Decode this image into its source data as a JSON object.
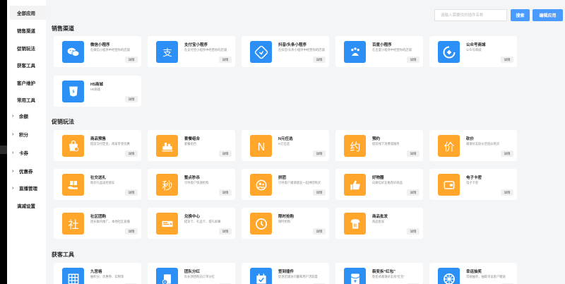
{
  "sidebar": {
    "items": [
      {
        "label": "全部应用",
        "has_arrow": false,
        "active": true
      },
      {
        "label": "销售渠道",
        "has_arrow": false
      },
      {
        "label": "促销玩法",
        "has_arrow": false
      },
      {
        "label": "获客工具",
        "has_arrow": false
      },
      {
        "label": "客户维护",
        "has_arrow": false
      },
      {
        "label": "常用工具",
        "has_arrow": false
      },
      {
        "label": "余额",
        "has_arrow": true
      },
      {
        "label": "积分",
        "has_arrow": true
      },
      {
        "label": "卡券",
        "has_arrow": true
      },
      {
        "label": "优惠券",
        "has_arrow": true
      },
      {
        "label": "直播管理",
        "has_arrow": true
      },
      {
        "label": "满减设置",
        "has_arrow": false
      }
    ]
  },
  "search": {
    "placeholder": "请输入需要找的插件名称",
    "search_label": "搜索",
    "edit_label": "编辑应用"
  },
  "detail_label": "详情",
  "sections": [
    {
      "title": "销售渠道",
      "cards": [
        {
          "name": "微信小程序",
          "desc": "在微信小程序中经营你的店铺",
          "icon": "wechat-icon",
          "color": "blue"
        },
        {
          "name": "支付宝小程序",
          "desc": "在支付宝小程序中经营你的店铺",
          "icon": "alipay-icon",
          "color": "blue"
        },
        {
          "name": "抖音/头条小程序",
          "desc": "在抖音/头条小程序中经营你的店铺",
          "icon": "douyin-icon",
          "color": "blue"
        },
        {
          "name": "百度小程序",
          "desc": "在百度小程序中经营你的店铺",
          "icon": "baidu-icon",
          "color": "blue"
        },
        {
          "name": "公众号商城",
          "desc": "公众号商城",
          "icon": "official-account-icon",
          "color": "blue"
        },
        {
          "name": "H5商城",
          "desc": "H5商城",
          "icon": "html5-icon",
          "color": "blue"
        }
      ]
    },
    {
      "title": "促销玩法",
      "cards": [
        {
          "name": "商品预售",
          "desc": "提前交付定金，商家享受优惠",
          "icon": "presale-bag-icon",
          "color": "orange"
        },
        {
          "name": "套餐组合",
          "desc": "套餐组合",
          "icon": "package-combo-icon",
          "color": "orange"
        },
        {
          "name": "N元任选",
          "desc": "N元任选",
          "icon": "n-yuan-icon",
          "glyph": "N",
          "color": "orange"
        },
        {
          "name": "预约",
          "desc": "提前线下消费或服务",
          "icon": "reservation-icon",
          "glyph": "约",
          "color": "orange"
        },
        {
          "name": "砍价",
          "desc": "邀请好友砍价后低价购买",
          "icon": "bargain-icon",
          "glyph": "价",
          "color": "orange"
        },
        {
          "name": "社交送礼",
          "desc": "购买礼品送给朋友",
          "icon": "gift-hand-icon",
          "color": "orange"
        },
        {
          "name": "整点秒杀",
          "desc": "引导客户快速抢购",
          "icon": "flash-sale-icon",
          "glyph": "秒",
          "color": "orange"
        },
        {
          "name": "拼团",
          "desc": "引导客户邀请朋友一起拼团购买",
          "icon": "group-buy-icon",
          "color": "orange"
        },
        {
          "name": "好物圈",
          "desc": "向微信好友推荐好商品",
          "icon": "thumbs-up-icon",
          "color": "orange"
        },
        {
          "name": "电子卡密",
          "desc": "电子卡密",
          "icon": "e-card-icon",
          "color": "orange"
        },
        {
          "name": "社区团购",
          "desc": "团长群内推广，本地社区直播",
          "icon": "community-bag-icon",
          "glyph": "社",
          "color": "orange"
        },
        {
          "name": "兑换中心",
          "desc": "提货卡、礼品卡、提礼屏幕",
          "icon": "exchange-card-icon",
          "color": "orange"
        },
        {
          "name": "限时抢购",
          "desc": "限时抢购",
          "icon": "clock-icon",
          "color": "orange"
        },
        {
          "name": "商品批发",
          "desc": "商品批发",
          "icon": "wholesale-icon",
          "color": "orange"
        }
      ]
    },
    {
      "title": "获客工具",
      "cards": [
        {
          "name": "九宫格",
          "desc": "抽积分、优惠券、实物等",
          "icon": "grid-icon",
          "color": "blue"
        },
        {
          "name": "团队分红",
          "desc": "队长领团购员订单分红",
          "icon": "team-bonus-icon",
          "color": "blue"
        },
        {
          "name": "签到插件",
          "desc": "促进店铺访问量和用户活跃度",
          "icon": "checkin-icon",
          "color": "blue"
        },
        {
          "name": "裂变拆“红包”",
          "desc": "裂变式邀请好友拆“红包”",
          "icon": "red-envelope-icon",
          "color": "blue"
        },
        {
          "name": "幸运抽奖",
          "desc": "常规抽奖，抽取幸运客户赠送",
          "icon": "wheel-icon",
          "color": "blue"
        }
      ]
    }
  ]
}
